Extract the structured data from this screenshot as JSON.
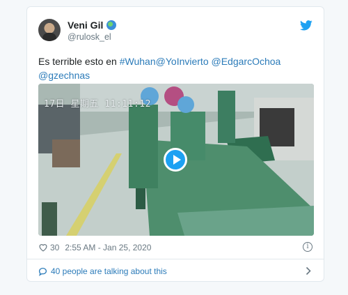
{
  "author": {
    "name": "Veni Gil",
    "name_emoji_icon": "globe-icon",
    "handle": "@rulosk_el"
  },
  "tweet": {
    "text_prefix": "Es terrible esto en ",
    "links": [
      "#Wuhan",
      "@YoInvierto",
      "@EdgarcOchoa",
      "@gzechnas"
    ]
  },
  "media": {
    "overlay_text": "17日 星期五 11:11:12",
    "play_icon": "play-icon"
  },
  "meta": {
    "likes": "30",
    "timestamp": "2:55 AM - Jan 25, 2020"
  },
  "footer": {
    "talking": "40 people are talking about this"
  },
  "colors": {
    "link": "#2b7bb9",
    "twitter_blue": "#1da1f2",
    "muted": "#697882",
    "border": "#e1e8ed"
  }
}
